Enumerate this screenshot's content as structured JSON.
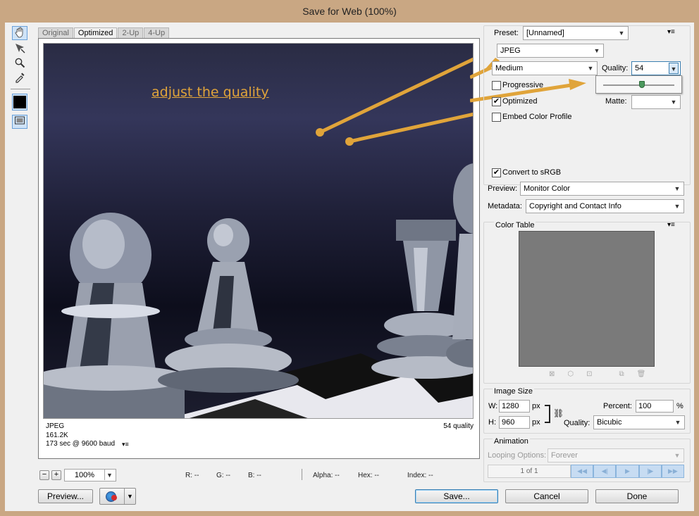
{
  "window": {
    "title": "Save for Web (100%)"
  },
  "tabs": [
    "Original",
    "Optimized",
    "2-Up",
    "4-Up"
  ],
  "annotation": {
    "text": "adjust the quality",
    "color": "#e0a43a"
  },
  "image_info": {
    "format": "JPEG",
    "size": "161.2K",
    "time": "173 sec @ 9600 baud",
    "quality": "54 quality"
  },
  "zoom": {
    "value": "100%",
    "minus": "−",
    "plus": "+"
  },
  "status": {
    "r": "R: --",
    "g": "G: --",
    "b": "B: --",
    "alpha": "Alpha: --",
    "hex": "Hex: --",
    "index": "Index: --"
  },
  "buttons": {
    "preview": "Preview...",
    "save": "Save...",
    "cancel": "Cancel",
    "done": "Done"
  },
  "settings": {
    "preset_label": "Preset:",
    "preset_value": "[Unnamed]",
    "format": "JPEG",
    "quality_preset": "Medium",
    "quality_label": "Quality:",
    "quality_value": "54",
    "quality_fraction": 0.54,
    "progressive": "Progressive",
    "optimized": "Optimized",
    "embed_profile": "Embed Color Profile",
    "matte_label": "Matte:",
    "convert_srgb": "Convert to sRGB",
    "preview_label": "Preview:",
    "preview_value": "Monitor Color",
    "metadata_label": "Metadata:",
    "metadata_value": "Copyright and Contact Info"
  },
  "color_table": {
    "title": "Color Table",
    "swatch": "#7a7a7a"
  },
  "image_size": {
    "title": "Image Size",
    "w_label": "W:",
    "w_value": "1280",
    "h_label": "H:",
    "h_value": "960",
    "unit": "px",
    "percent_label": "Percent:",
    "percent_value": "100",
    "percent_unit": "%",
    "quality_label": "Quality:",
    "quality_value": "Bicubic"
  },
  "animation": {
    "title": "Animation",
    "looping_label": "Looping Options:",
    "looping_value": "Forever",
    "frame": "1 of 1"
  }
}
